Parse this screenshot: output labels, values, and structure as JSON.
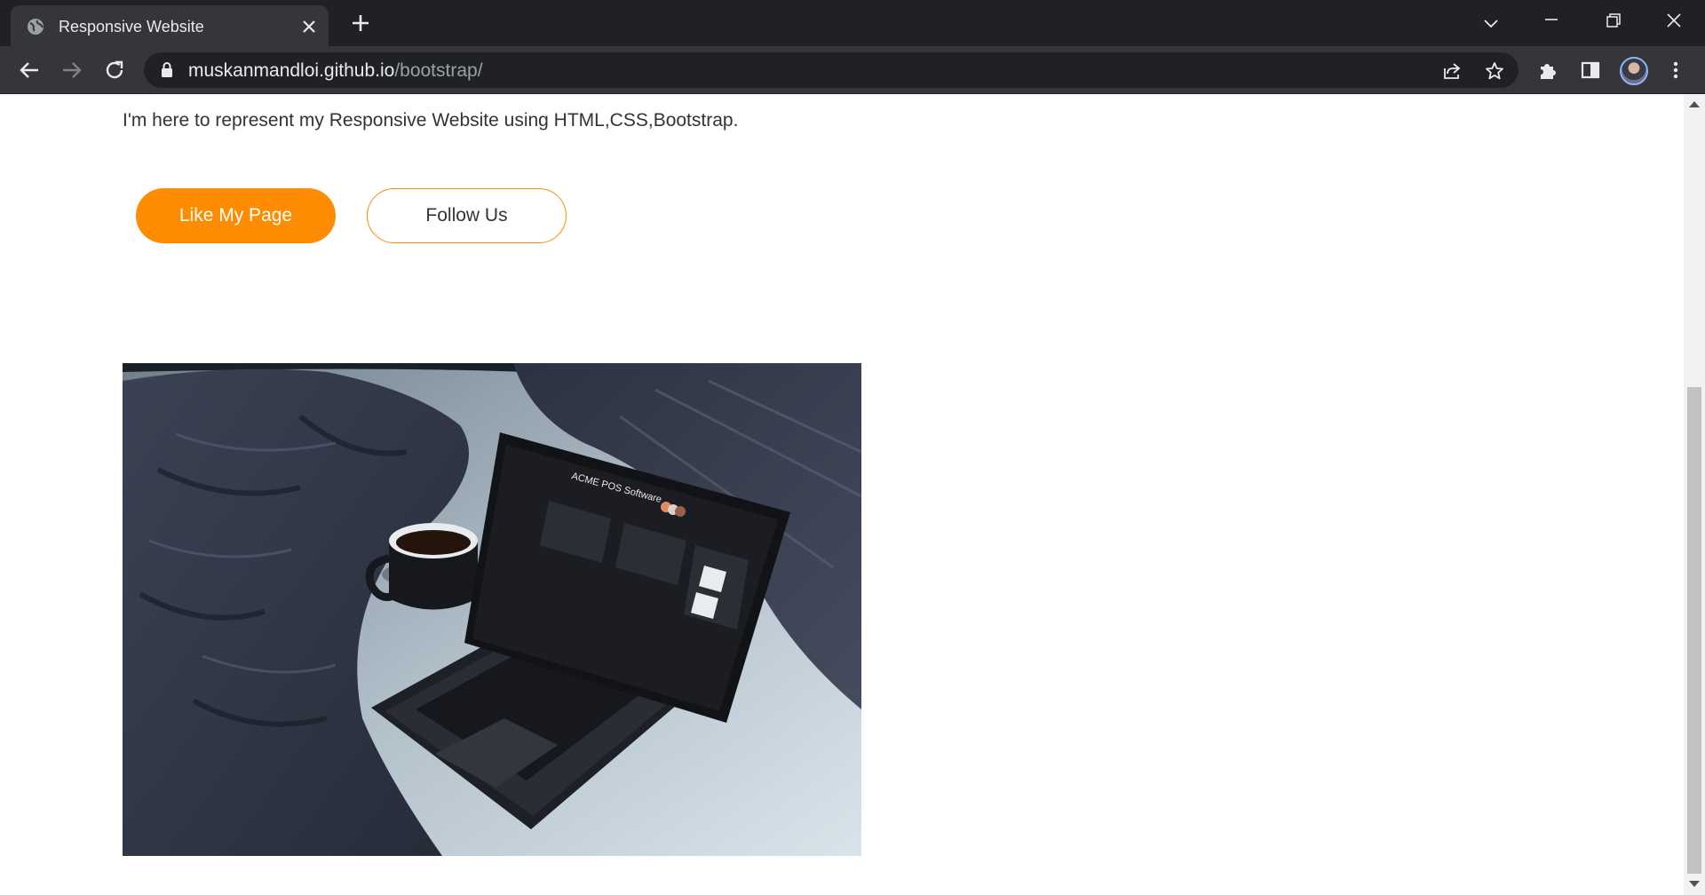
{
  "browser": {
    "tab_title": "Responsive Website",
    "url_host": "muskanmandloi.github.io",
    "url_path": "/bootstrap/"
  },
  "page": {
    "intro_text": "I'm here to represent my Responsive Website using HTML,CSS,Bootstrap.",
    "like_button_label": "Like My Page",
    "follow_button_label": "Follow Us",
    "hero_screen_title": "ACME POS Software",
    "accent_color": "#fd8c00"
  },
  "icons": [
    "globe-icon",
    "close-icon",
    "plus-icon",
    "chevron-down-icon",
    "minimize-icon",
    "restore-icon",
    "back-icon",
    "forward-icon",
    "reload-icon",
    "lock-icon",
    "share-icon",
    "star-icon",
    "extensions-icon",
    "side-panel-icon",
    "menu-icon"
  ]
}
